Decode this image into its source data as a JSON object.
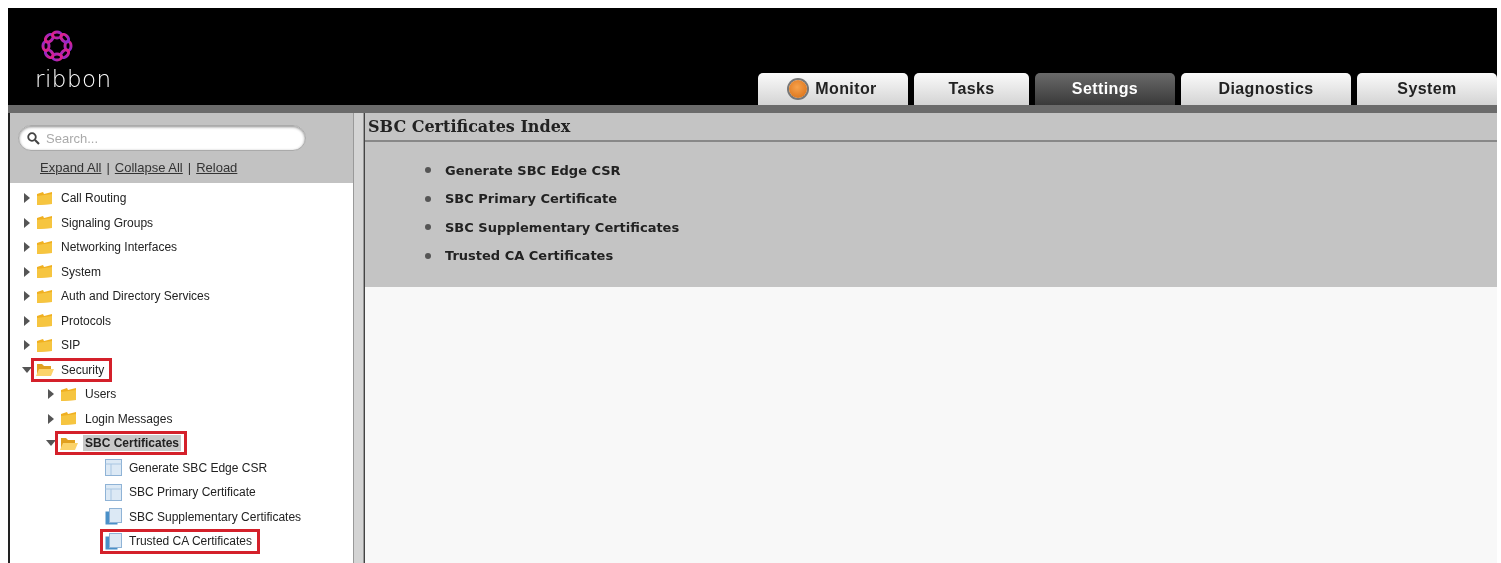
{
  "header": {
    "logo_text": "ribbon",
    "tabs": [
      {
        "label": "Monitor",
        "selected": false,
        "kind": "status"
      },
      {
        "label": "Tasks",
        "selected": false,
        "kind": "plain"
      },
      {
        "label": "Settings",
        "selected": true,
        "kind": "plain"
      },
      {
        "label": "Diagnostics",
        "selected": false,
        "kind": "plain"
      },
      {
        "label": "System",
        "selected": false,
        "kind": "plain"
      }
    ]
  },
  "sidebar": {
    "search": {
      "placeholder": "Search..."
    },
    "links": [
      "Expand All",
      "Collapse All",
      "Reload"
    ],
    "separator": "|",
    "tree": [
      {
        "label": "Call Routing",
        "kind": "folder",
        "expanded": false,
        "selected": false,
        "highlighted": false
      },
      {
        "label": "Signaling Groups",
        "kind": "folder",
        "expanded": false,
        "selected": false,
        "highlighted": false
      },
      {
        "label": "Networking Interfaces",
        "kind": "folder",
        "expanded": false,
        "selected": false,
        "highlighted": false
      },
      {
        "label": "System",
        "kind": "folder",
        "expanded": false,
        "selected": false,
        "highlighted": false
      },
      {
        "label": "Auth and Directory Services",
        "kind": "folder",
        "expanded": false,
        "selected": false,
        "highlighted": false
      },
      {
        "label": "Protocols",
        "kind": "folder",
        "expanded": false,
        "selected": false,
        "highlighted": false
      },
      {
        "label": "SIP",
        "kind": "folder",
        "expanded": false,
        "selected": false,
        "highlighted": false
      },
      {
        "label": "Security",
        "kind": "folder",
        "expanded": true,
        "selected": false,
        "highlighted": true,
        "children": [
          {
            "label": "Users",
            "kind": "folder",
            "expanded": false,
            "selected": false,
            "highlighted": false
          },
          {
            "label": "Login Messages",
            "kind": "folder",
            "expanded": false,
            "selected": false,
            "highlighted": false
          },
          {
            "label": "SBC Certificates",
            "kind": "folder",
            "expanded": true,
            "selected": true,
            "highlighted": true,
            "children": [
              {
                "label": "Generate SBC Edge CSR",
                "kind": "page",
                "selected": false,
                "highlighted": false
              },
              {
                "label": "SBC Primary Certificate",
                "kind": "page",
                "selected": false,
                "highlighted": false
              },
              {
                "label": "SBC Supplementary Certificates",
                "kind": "page-stack",
                "selected": false,
                "highlighted": false
              },
              {
                "label": "Trusted CA Certificates",
                "kind": "page-stack",
                "selected": false,
                "highlighted": true
              }
            ]
          }
        ]
      }
    ]
  },
  "main": {
    "title": "SBC Certificates Index",
    "links": [
      "Generate SBC Edge CSR",
      "SBC Primary Certificate",
      "SBC Supplementary Certificates",
      "Trusted CA Certificates"
    ]
  }
}
